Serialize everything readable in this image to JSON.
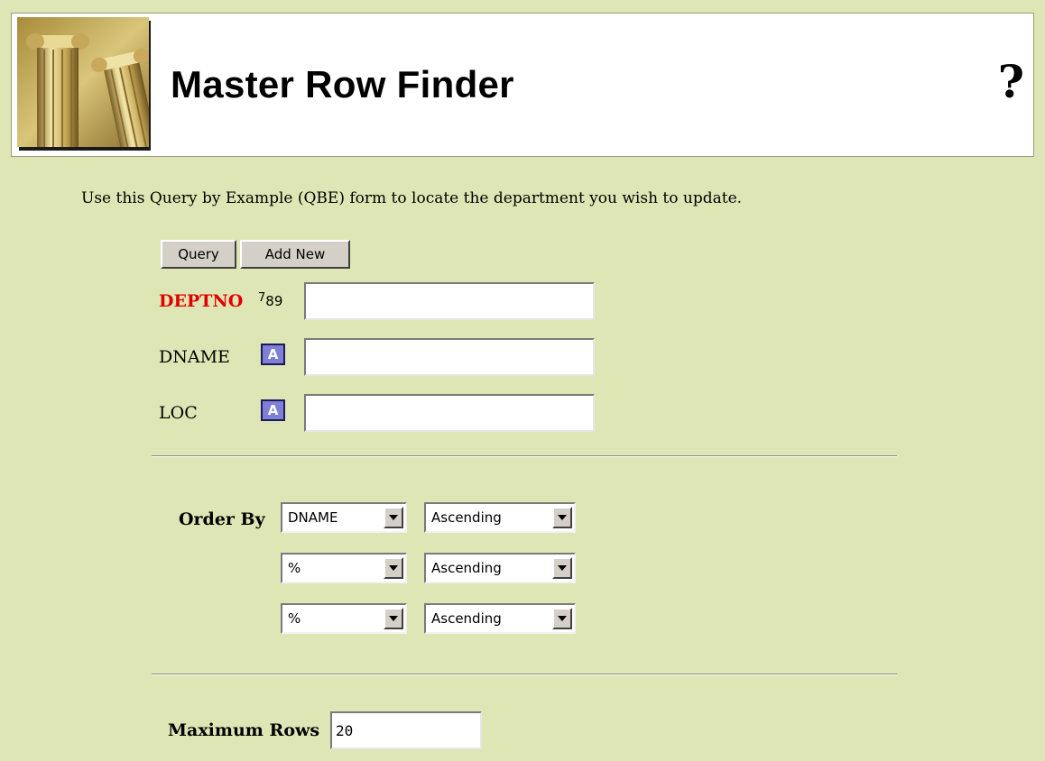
{
  "header": {
    "title": "Master Row Finder",
    "help_label": "?"
  },
  "instructions": "Use this Query by Example (QBE) form to locate the department you wish to update.",
  "buttons": {
    "query": "Query",
    "add_new": "Add New"
  },
  "fields": [
    {
      "label": "DEPTNO",
      "required": true,
      "type_icon": "numeric-type-icon",
      "type_text": "789",
      "value": ""
    },
    {
      "label": "DNAME",
      "required": false,
      "type_icon": "alpha-type-icon",
      "type_text": "A",
      "value": ""
    },
    {
      "label": "LOC",
      "required": false,
      "type_icon": "alpha-type-icon",
      "type_text": "A",
      "value": ""
    }
  ],
  "order_by": {
    "label": "Order By",
    "rows": [
      {
        "column": "DNAME",
        "direction": "Ascending"
      },
      {
        "column": "%",
        "direction": "Ascending"
      },
      {
        "column": "%",
        "direction": "Ascending"
      }
    ]
  },
  "max_rows": {
    "label": "Maximum Rows",
    "value": "20"
  },
  "colors": {
    "page_background": "#dfe6b5",
    "required_label": "#e00000",
    "alpha_icon": "#7f7fd6"
  }
}
